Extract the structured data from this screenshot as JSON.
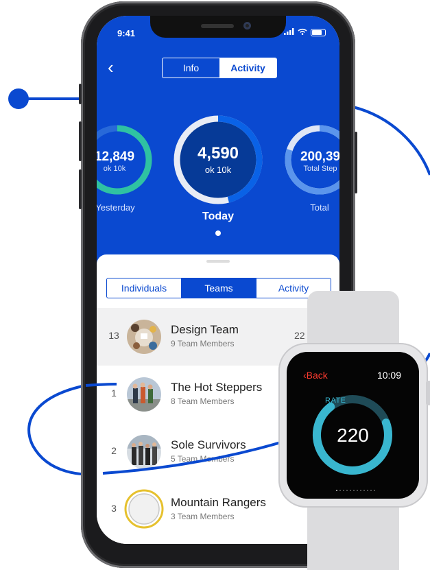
{
  "status_bar": {
    "time": "9:41"
  },
  "header": {
    "back_glyph": "‹",
    "tabs": [
      {
        "label": "Info"
      },
      {
        "label": "Activity"
      }
    ]
  },
  "stats": [
    {
      "value": "12,849",
      "caption": "ok 10k",
      "label": "Yesterday",
      "progress": 0.7
    },
    {
      "value": "4,590",
      "caption": "ok 10k",
      "label": "Today",
      "progress": 0.46
    },
    {
      "value": "200,39",
      "caption": "Total Step",
      "label": "Total",
      "progress": 0.8
    }
  ],
  "list_tabs": [
    {
      "label": "Individuals"
    },
    {
      "label": "Teams"
    },
    {
      "label": "Activity"
    }
  ],
  "teams": [
    {
      "rank": "13",
      "name": "Design Team",
      "members": "9 Team Members",
      "steps": "22"
    },
    {
      "rank": "1",
      "name": "The Hot Steppers",
      "members": "8 Team Members",
      "steps": ""
    },
    {
      "rank": "2",
      "name": "Sole Survivors",
      "members": "5 Team Members",
      "steps": ""
    },
    {
      "rank": "3",
      "name": "Mountain Rangers",
      "members": "3 Team Members",
      "steps": ""
    }
  ],
  "watch": {
    "back_label": "‹Back",
    "time": "10:09",
    "metric_label": "RATE",
    "metric_value": "220",
    "progress": 0.7
  },
  "colors": {
    "brand_blue": "#0a49d0",
    "ring_green": "#2fc2a2",
    "watch_accent": "#39b6cf",
    "deco_line": "#0a49d0"
  }
}
